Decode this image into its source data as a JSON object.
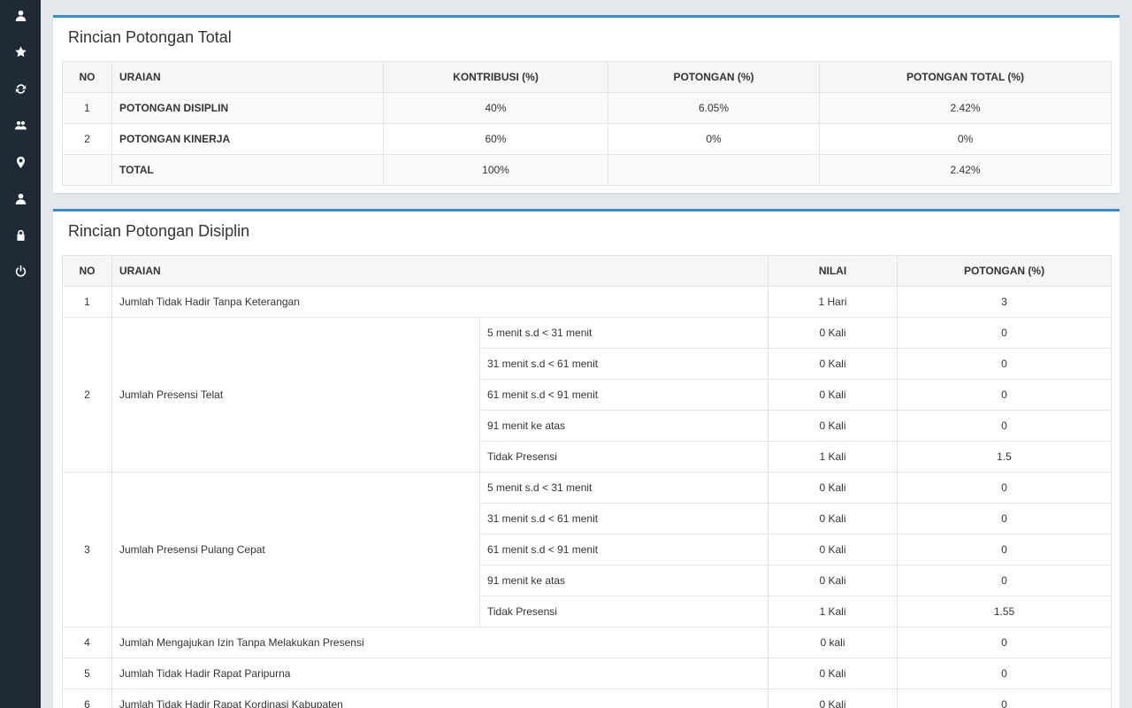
{
  "sidebar": {
    "items": [
      {
        "icon": "user-icon"
      },
      {
        "icon": "star-icon"
      },
      {
        "icon": "refresh-icon"
      },
      {
        "icon": "users-icon"
      },
      {
        "icon": "map-marker-icon"
      },
      {
        "icon": "user-icon"
      },
      {
        "icon": "lock-icon"
      },
      {
        "icon": "power-icon"
      }
    ]
  },
  "total_panel": {
    "title": "Rincian Potongan Total",
    "headers": [
      "NO",
      "URAIAN",
      "KONTRIBUSI (%)",
      "POTONGAN (%)",
      "POTONGAN TOTAL (%)"
    ],
    "rows": [
      {
        "no": "1",
        "uraian": "POTONGAN DISIPLIN",
        "kontribusi": "40%",
        "potongan": "6.05%",
        "total": "2.42%"
      },
      {
        "no": "2",
        "uraian": "POTONGAN KINERJA",
        "kontribusi": "60%",
        "potongan": "0%",
        "total": "0%"
      },
      {
        "no": "",
        "uraian": "TOTAL",
        "kontribusi": "100%",
        "potongan": "",
        "total": "2.42%"
      }
    ]
  },
  "disiplin_panel": {
    "title": "Rincian Potongan Disiplin",
    "headers": [
      "NO",
      "URAIAN",
      "NILAI",
      "POTONGAN (%)"
    ],
    "row1": {
      "no": "1",
      "uraian": "Jumlah Tidak Hadir Tanpa Keterangan",
      "nilai": "1 Hari",
      "potongan": "3"
    },
    "row2": {
      "no": "2",
      "uraian": "Jumlah Presensi Telat",
      "subs": [
        {
          "label": "5 menit s.d < 31 menit",
          "nilai": "0 Kali",
          "potongan": "0"
        },
        {
          "label": "31 menit s.d < 61 menit",
          "nilai": "0 Kali",
          "potongan": "0"
        },
        {
          "label": "61 menit s.d < 91 menit",
          "nilai": "0 Kali",
          "potongan": "0"
        },
        {
          "label": "91 menit ke atas",
          "nilai": "0 Kali",
          "potongan": "0"
        },
        {
          "label": "Tidak Presensi",
          "nilai": "1 Kali",
          "potongan": "1.5"
        }
      ]
    },
    "row3": {
      "no": "3",
      "uraian": "Jumlah Presensi Pulang Cepat",
      "subs": [
        {
          "label": "5 menit s.d < 31 menit",
          "nilai": "0 Kali",
          "potongan": "0"
        },
        {
          "label": "31 menit s.d < 61 menit",
          "nilai": "0 Kali",
          "potongan": "0"
        },
        {
          "label": "61 menit s.d < 91 menit",
          "nilai": "0 Kali",
          "potongan": "0"
        },
        {
          "label": "91 menit ke atas",
          "nilai": "0 Kali",
          "potongan": "0"
        },
        {
          "label": "Tidak Presensi",
          "nilai": "1 Kali",
          "potongan": "1.55"
        }
      ]
    },
    "row4": {
      "no": "4",
      "uraian": "Jumlah Mengajukan Izin Tanpa Melakukan Presensi",
      "nilai": "0 kali",
      "potongan": "0"
    },
    "row5": {
      "no": "5",
      "uraian": "Jumlah Tidak Hadir Rapat Paripurna",
      "nilai": "0 Kali",
      "potongan": "0"
    },
    "row6": {
      "no": "6",
      "uraian": "Jumlah Tidak Hadir Rapat Kordinasi Kabupaten",
      "nilai": "0 Kali",
      "potongan": "0"
    }
  }
}
